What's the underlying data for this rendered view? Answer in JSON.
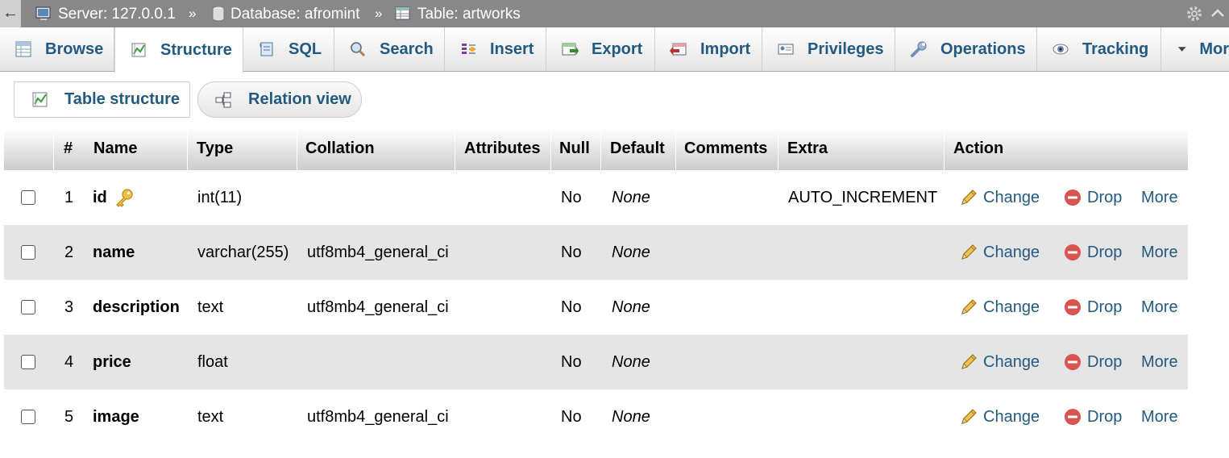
{
  "breadcrumb": {
    "back_label": "←",
    "server": "Server: 127.0.0.1",
    "database": "Database: afromint",
    "table": "Table: artworks",
    "separator": "»"
  },
  "tabs": [
    {
      "label": "Browse",
      "icon": "browse-icon"
    },
    {
      "label": "Structure",
      "icon": "structure-icon",
      "active": true
    },
    {
      "label": "SQL",
      "icon": "sql-icon"
    },
    {
      "label": "Search",
      "icon": "search-icon"
    },
    {
      "label": "Insert",
      "icon": "insert-icon"
    },
    {
      "label": "Export",
      "icon": "export-icon"
    },
    {
      "label": "Import",
      "icon": "import-icon"
    },
    {
      "label": "Privileges",
      "icon": "privileges-icon"
    },
    {
      "label": "Operations",
      "icon": "operations-icon"
    },
    {
      "label": "Tracking",
      "icon": "tracking-icon"
    },
    {
      "label": "Mor",
      "icon": "dropdown-triangle-icon"
    }
  ],
  "subtabs": [
    {
      "label": "Table structure",
      "icon": "structure-icon"
    },
    {
      "label": "Relation view",
      "icon": "relation-icon"
    }
  ],
  "columns": [
    "#",
    "Name",
    "Type",
    "Collation",
    "Attributes",
    "Null",
    "Default",
    "Comments",
    "Extra",
    "Action"
  ],
  "rows": [
    {
      "num": "1",
      "name": "id",
      "primary_key": true,
      "type": "int(11)",
      "collation": "",
      "attributes": "",
      "null": "No",
      "default": "None",
      "comments": "",
      "extra": "AUTO_INCREMENT"
    },
    {
      "num": "2",
      "name": "name",
      "primary_key": false,
      "type": "varchar(255)",
      "collation": "utf8mb4_general_ci",
      "attributes": "",
      "null": "No",
      "default": "None",
      "comments": "",
      "extra": ""
    },
    {
      "num": "3",
      "name": "description",
      "primary_key": false,
      "type": "text",
      "collation": "utf8mb4_general_ci",
      "attributes": "",
      "null": "No",
      "default": "None",
      "comments": "",
      "extra": ""
    },
    {
      "num": "4",
      "name": "price",
      "primary_key": false,
      "type": "float",
      "collation": "",
      "attributes": "",
      "null": "No",
      "default": "None",
      "comments": "",
      "extra": ""
    },
    {
      "num": "5",
      "name": "image",
      "primary_key": false,
      "type": "text",
      "collation": "utf8mb4_general_ci",
      "attributes": "",
      "null": "No",
      "default": "None",
      "comments": "",
      "extra": ""
    }
  ],
  "actions": {
    "change": "Change",
    "drop": "Drop",
    "more": "More"
  },
  "colors": {
    "link": "#235a81",
    "breadcrumb_bg": "#888888",
    "row_alt": "#e5e5e5",
    "drop_icon": "#d9534f",
    "key_icon": "#e6b422"
  }
}
